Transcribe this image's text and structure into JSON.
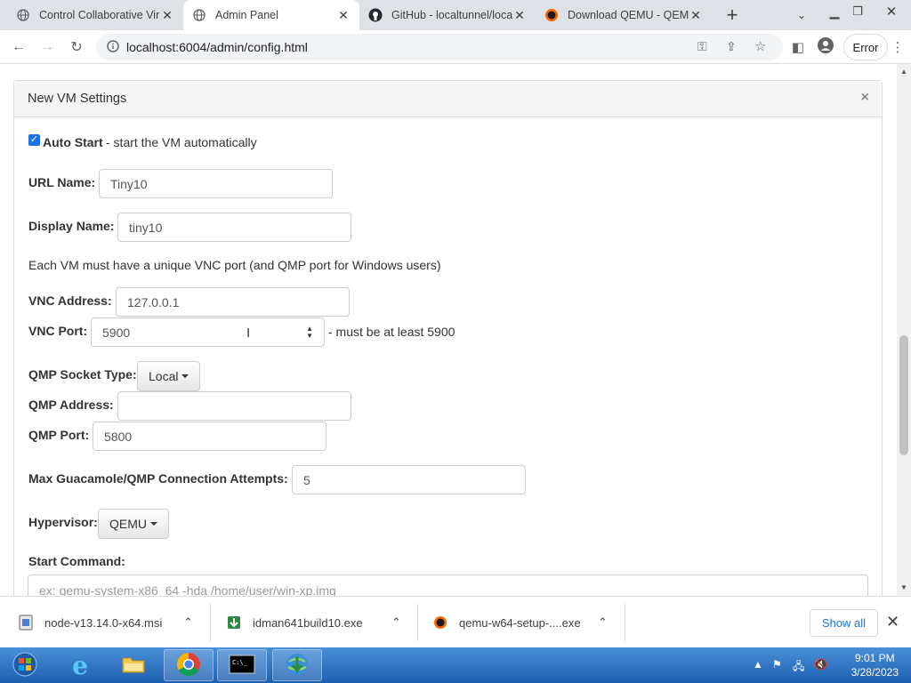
{
  "tabs": [
    {
      "title": "Control Collaborative Vir",
      "icon": "globe-icon",
      "active": false
    },
    {
      "title": "Admin Panel",
      "icon": "globe-icon",
      "active": true
    },
    {
      "title": "GitHub - localtunnel/loca",
      "icon": "github-icon",
      "active": false
    },
    {
      "title": "Download QEMU - QEMU",
      "icon": "qemu-icon",
      "active": false
    }
  ],
  "toolbar": {
    "url": "localhost:6004/admin/config.html",
    "error_label": "Error"
  },
  "panel": {
    "title": "New VM Settings",
    "close_glyph": "×"
  },
  "form": {
    "auto_start_label": "Auto Start",
    "auto_start_desc": " - start the VM automatically",
    "auto_start_checked": true,
    "url_name_label": "URL Name:",
    "url_name_value": "Tiny10",
    "display_name_label": "Display Name:",
    "display_name_value": "tiny10",
    "vnc_note": "Each VM must have a unique VNC port (and QMP port for Windows users)",
    "vnc_address_label": "VNC Address:",
    "vnc_address_value": "127.0.0.1",
    "vnc_port_label": "VNC Port:",
    "vnc_port_value": "5900",
    "vnc_port_hint": "- must be at least 5900",
    "qmp_socket_type_label": "QMP Socket Type:",
    "qmp_socket_type_value": "Local",
    "qmp_address_label": "QMP Address:",
    "qmp_address_value": "",
    "qmp_port_label": "QMP Port:",
    "qmp_port_value": "5800",
    "max_attempts_label": "Max Guacamole/QMP Connection Attempts:",
    "max_attempts_value": "5",
    "hypervisor_label": "Hypervisor:",
    "hypervisor_value": "QEMU",
    "start_command_label": "Start Command:",
    "start_command_placeholder": "ex: qemu-system-x86_64 -hda /home/user/win-xp.img"
  },
  "downloads": [
    {
      "name": "node-v13.14.0-x64.msi",
      "icon": "msi-icon"
    },
    {
      "name": "idman641build10.exe",
      "icon": "idm-icon"
    },
    {
      "name": "qemu-w64-setup-....exe",
      "icon": "qemu-icon"
    }
  ],
  "downloads_show_all": "Show all",
  "taskbar": {
    "time": "9:01 PM",
    "date": "3/28/2023"
  }
}
